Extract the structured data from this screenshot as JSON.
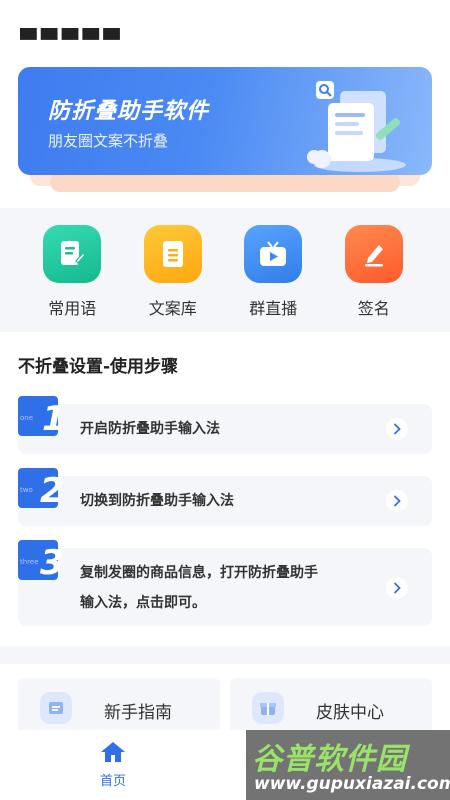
{
  "banner": {
    "title": "防折叠助手软件",
    "subtitle": "朋友圈文案不折叠"
  },
  "grid": [
    {
      "label": "常用语",
      "icon": "edit-doc-icon",
      "color": "#1fc9a0"
    },
    {
      "label": "文案库",
      "icon": "document-icon",
      "color": "#ffb51e"
    },
    {
      "label": "群直播",
      "icon": "tv-play-icon",
      "color": "#3f8ff5"
    },
    {
      "label": "签名",
      "icon": "pen-sign-icon",
      "color": "#ff6a3a"
    }
  ],
  "section": {
    "title": "不折叠设置-使用步骤"
  },
  "steps": [
    {
      "num": "1",
      "word": "one",
      "text": "开启防折叠助手输入法"
    },
    {
      "num": "2",
      "word": "two",
      "text": "切换到防折叠助手输入法"
    },
    {
      "num": "3",
      "word": "three",
      "line1": "复制发圈的商品信息，打开防折叠助手",
      "line2": "输入法，点击即可。"
    }
  ],
  "cards": [
    {
      "label": "新手指南",
      "icon": "guide-icon"
    },
    {
      "label": "皮肤中心",
      "icon": "gift-icon"
    }
  ],
  "tabbar": {
    "home_label": "首页",
    "accent": "#2f6fe8"
  },
  "watermark": {
    "big": "谷普软件园",
    "small": "www.gupuxiazai.com"
  }
}
